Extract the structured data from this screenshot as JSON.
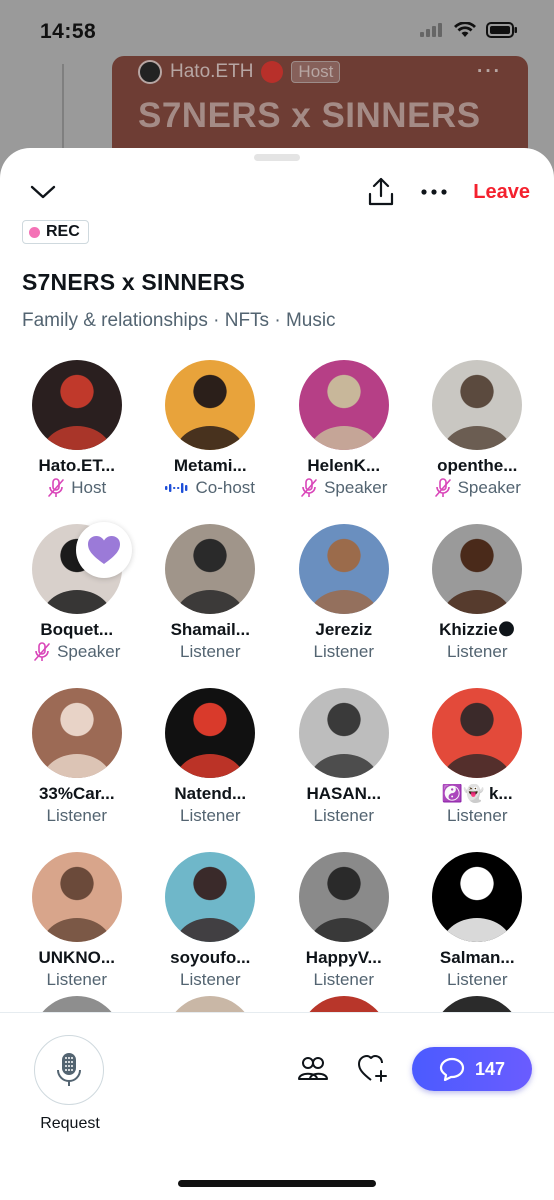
{
  "status_bar": {
    "time": "14:58"
  },
  "background_space": {
    "host_name": "Hato.ETH",
    "host_badge": "Host",
    "title": "S7NERS x SINNERS"
  },
  "sheet": {
    "leave_label": "Leave",
    "rec_label": "REC",
    "title": "S7NERS x SINNERS",
    "tags": "Family & relationships · NFTs · Music"
  },
  "participants": [
    {
      "name": "Hato.ET...",
      "role": "Host",
      "role_icon": "mic-muted-icon",
      "avatar_color": "#2a1f1f",
      "accent": "#c0392b"
    },
    {
      "name": "Metami...",
      "role": "Co-host",
      "role_icon": "audio-wave-icon",
      "avatar_color": "#e8a33b",
      "accent": "#2b1f1a"
    },
    {
      "name": "HelenK...",
      "role": "Speaker",
      "role_icon": "mic-muted-icon",
      "avatar_color": "#b63f86",
      "accent": "#c8b79a"
    },
    {
      "name": "openthe...",
      "role": "Speaker",
      "role_icon": "mic-muted-icon",
      "avatar_color": "#c9c7c2",
      "accent": "#5b4a3e"
    },
    {
      "name": "Boquet...",
      "role": "Speaker",
      "role_icon": "mic-muted-icon",
      "avatar_color": "#d8d0cb",
      "accent": "#1b1b1b",
      "reaction": "purple-heart-icon"
    },
    {
      "name": "Shamail...",
      "role": "Listener",
      "avatar_color": "#a0958a",
      "accent": "#2a2a2a"
    },
    {
      "name": "Jereziz",
      "role": "Listener",
      "avatar_color": "#6a8fbf",
      "accent": "#9b6b4b"
    },
    {
      "name": "Khizzie🌑",
      "role": "Listener",
      "avatar_color": "#9a9a9a",
      "accent": "#4a2a1a"
    },
    {
      "name": "33%Car...",
      "role": "Listener",
      "avatar_color": "#9c6a55",
      "accent": "#e8d3c7"
    },
    {
      "name": "Natend...",
      "role": "Listener",
      "avatar_color": "#111111",
      "accent": "#d93a2b"
    },
    {
      "name": "HASAN...",
      "role": "Listener",
      "avatar_color": "#bdbdbd",
      "accent": "#3a3a3a"
    },
    {
      "name": "☯️👻 k...",
      "role": "Listener",
      "avatar_color": "#e34a3a",
      "accent": "#3b2a2a"
    },
    {
      "name": "UNKNO...",
      "role": "Listener",
      "avatar_color": "#d8a58b",
      "accent": "#6b4a3a"
    },
    {
      "name": "soyoufo...",
      "role": "Listener",
      "avatar_color": "#6fb7c9",
      "accent": "#3a2a2a"
    },
    {
      "name": "HappyV...",
      "role": "Listener",
      "avatar_color": "#8a8a8a",
      "accent": "#2a2a2a"
    },
    {
      "name": "Salman...",
      "role": "Listener",
      "avatar_color": "#000000",
      "accent": "#ffffff"
    }
  ],
  "bottom_bar": {
    "request_label": "Request",
    "comment_count": "147"
  }
}
